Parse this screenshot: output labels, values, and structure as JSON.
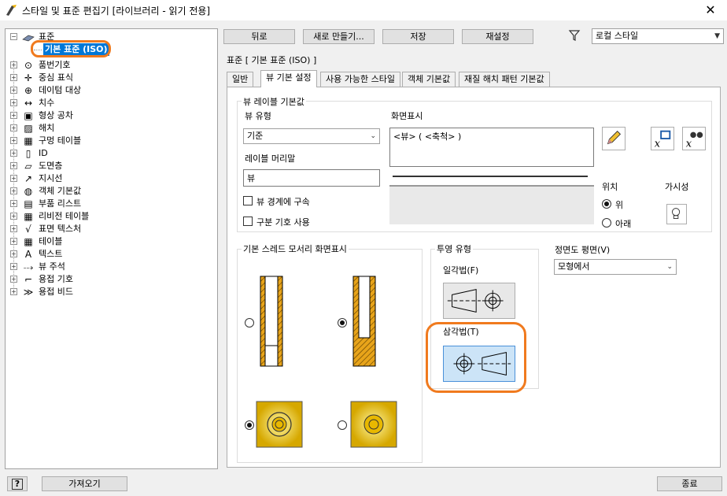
{
  "window": {
    "title": "스타일 및 표준 편집기 [라이브러리 - 읽기 전용]",
    "close_glyph": "✕"
  },
  "tree": {
    "root": "표준",
    "selected": "기본 표준 (ISO)",
    "items": [
      "품번기호",
      "중심 표식",
      "데이텀 대상",
      "치수",
      "형상 공차",
      "해치",
      "구멍 테이블",
      "ID",
      "도면층",
      "지시선",
      "객체 기본값",
      "부품 리스트",
      "리비전 테이블",
      "표면 텍스처",
      "테이블",
      "텍스트",
      "뷰 주석",
      "용접 기호",
      "용접 비드"
    ]
  },
  "toolbar": {
    "back": "뒤로",
    "new": "새로 만들기...",
    "save": "저장",
    "reset": "재설정",
    "filter_value": "로컬 스타일"
  },
  "header": {
    "section": "표준 [ 기본 표준 (ISO) ]"
  },
  "tabs": [
    "일반",
    "뷰 기본 설정",
    "사용 가능한 스타일",
    "객체 기본값",
    "재질 해치 패턴 기본값"
  ],
  "view_label": {
    "group_title": "뷰 레이블 기본값",
    "view_type_label": "뷰 유형",
    "view_type_value": "기준",
    "display_label": "화면표시",
    "display_value": "<뷰> ( <축척> )",
    "prefix_label": "레이블 머리말",
    "prefix_value": "뷰",
    "constrain_label": "뷰 경계에 구속",
    "delimiter_label": "구분 기호 사용",
    "position_label": "위치",
    "pos_top": "위",
    "pos_bottom": "아래",
    "visibility_label": "가시성"
  },
  "thread": {
    "group_title": "기본 스레드 모서리 화면표시"
  },
  "projection": {
    "group_title": "투영 유형",
    "first_angle": "일각법(F)",
    "third_angle": "삼각법(T)"
  },
  "elevation": {
    "label": "정면도 평면(V)",
    "value": "모형에서"
  },
  "footer": {
    "help": "?",
    "import": "가져오기",
    "close": "종료"
  },
  "colors": {
    "selection": "#0078d7",
    "highlight_ring": "#f07a1e",
    "thread_gold": "#e8a41a"
  }
}
